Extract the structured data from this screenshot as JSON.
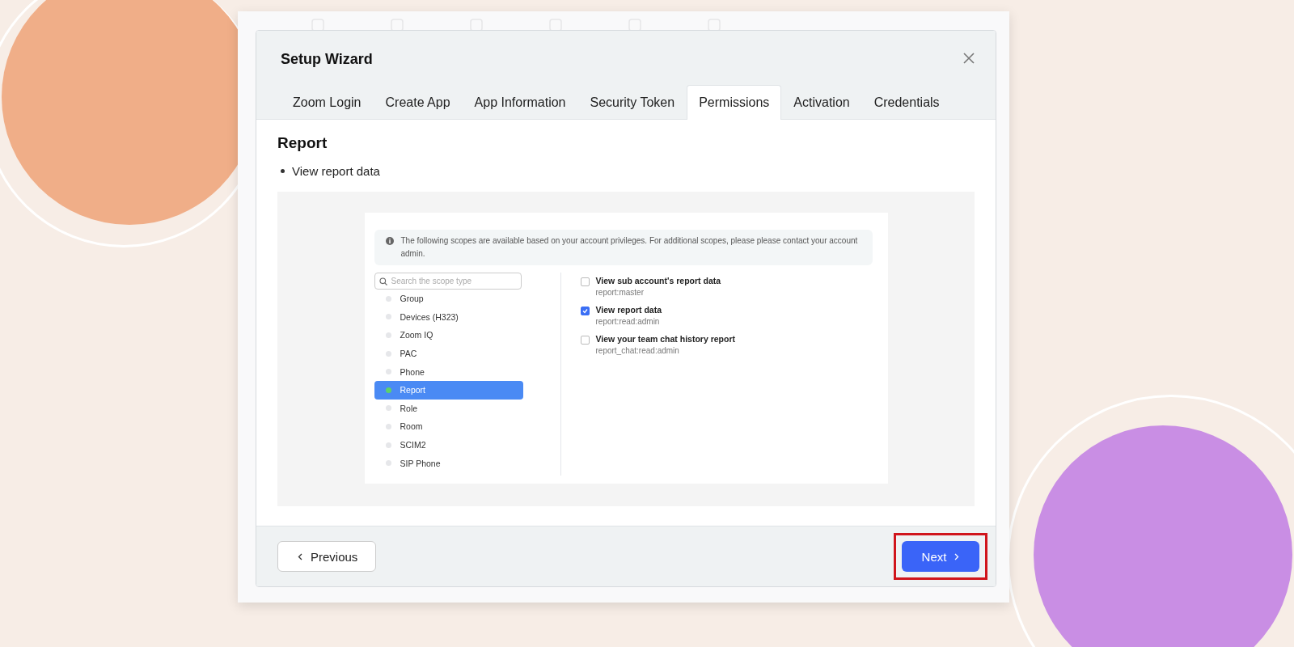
{
  "dialog": {
    "title": "Setup Wizard",
    "tabs": [
      {
        "label": "Zoom Login",
        "selected": false
      },
      {
        "label": "Create App",
        "selected": false
      },
      {
        "label": "App Information",
        "selected": false
      },
      {
        "label": "Security Token",
        "selected": false
      },
      {
        "label": "Permissions",
        "selected": true
      },
      {
        "label": "Activation",
        "selected": false
      },
      {
        "label": "Credentials",
        "selected": false
      }
    ],
    "section_title": "Report",
    "bullets": [
      "View report data"
    ],
    "screenshot": {
      "notice": "The following scopes are available based on your account privileges. For additional scopes, please please contact your account admin.",
      "search": {
        "placeholder": "Search the scope type"
      },
      "categories": [
        {
          "label": "Group",
          "selected": false
        },
        {
          "label": "Devices (H323)",
          "selected": false
        },
        {
          "label": "Zoom IQ",
          "selected": false
        },
        {
          "label": "PAC",
          "selected": false
        },
        {
          "label": "Phone",
          "selected": false
        },
        {
          "label": "Report",
          "selected": true
        },
        {
          "label": "Role",
          "selected": false
        },
        {
          "label": "Room",
          "selected": false
        },
        {
          "label": "SCIM2",
          "selected": false
        },
        {
          "label": "SIP Phone",
          "selected": false
        }
      ],
      "scopes": [
        {
          "title": "View sub account's report data",
          "code": "report:master",
          "checked": false
        },
        {
          "title": "View report data",
          "code": "report:read:admin",
          "checked": true
        },
        {
          "title": "View your team chat history report",
          "code": "report_chat:read:admin",
          "checked": false
        }
      ]
    },
    "buttons": {
      "previous": "Previous",
      "next": "Next",
      "next_highlighted": true
    }
  }
}
